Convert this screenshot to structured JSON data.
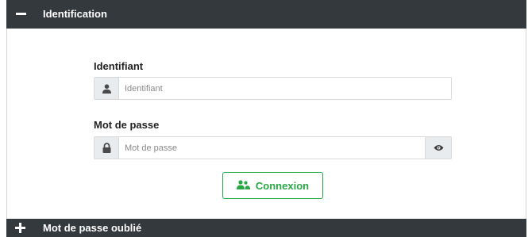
{
  "sections": {
    "identification": {
      "title": "Identification",
      "toggle_icon": "minus-icon",
      "expanded": true
    },
    "forgot_password": {
      "title": "Mot de passe oublié",
      "toggle_icon": "plus-icon",
      "expanded": false
    }
  },
  "form": {
    "username": {
      "label": "Identifiant",
      "placeholder": "Identifiant",
      "value": "",
      "icon": "user-icon"
    },
    "password": {
      "label": "Mot de passe",
      "placeholder": "Mot de passe",
      "value": "",
      "icon": "lock-icon",
      "toggle_icon": "eye-icon"
    },
    "submit": {
      "label": "Connexion",
      "icon": "users-icon"
    }
  },
  "colors": {
    "header_bg": "#34393e",
    "accent_green": "#28a745",
    "addon_bg": "#e9ecef",
    "icon_dark": "#4a4a4a"
  }
}
